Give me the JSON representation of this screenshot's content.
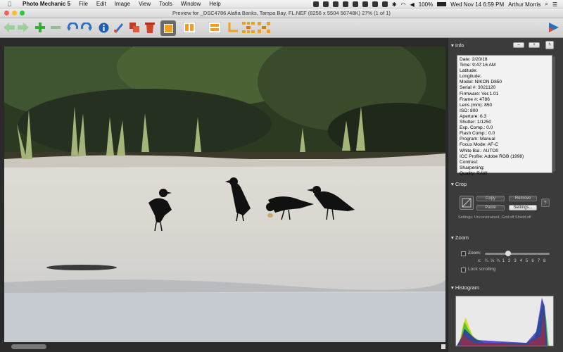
{
  "menubar": {
    "app_name": "Photo Mechanic 5",
    "menus": [
      "File",
      "Edit",
      "Image",
      "View",
      "Tools",
      "Window",
      "Help"
    ],
    "battery": "100%",
    "datetime": "Wed Nov 14  6:59 PM",
    "user": "Arthur Morris"
  },
  "window": {
    "title": "Preview for _DSC4786  Alafia Banks, Tampa Bay, FL.NEF (8256 x 5504 56748K) 27% (1 of 1)"
  },
  "panel": {
    "info": {
      "header": "Info",
      "lines": [
        "Date: 2/20/18",
        "Time: 9:47:16 AM",
        "Latitude:",
        "Longitude:",
        "Model: NIKON D850",
        "Serial #: 3021120",
        "Firmware: Ver.1.01",
        "Frame #: 4786",
        "Lens (mm): 850",
        "ISO: 800",
        "Aperture: 6.3",
        "Shutter: 1/1250",
        "Exp. Comp.: 0.0",
        "Flash Comp.: 0.0",
        "Program: Manual",
        "Focus Mode: AF-C",
        "White Bal.: AUTO0",
        "ICC Profile: Adobe RGB (1998)",
        "Contrast:",
        "Sharpening:",
        "Quality: RAW"
      ]
    },
    "crop": {
      "header": "Crop",
      "copy": "Copy",
      "remove": "Remove",
      "paste": "Paste",
      "settings": "Settings...",
      "settings_text": "Settings:   Unconstrained, Grid:off Shield:off"
    },
    "zoom": {
      "header": "Zoom",
      "zoom_label": "Zoom:",
      "scale": "x:   ¼  ⅓  ¾  1   2   3   4   5   6   7   8",
      "lock": "Lock scrolling",
      "slider_level": 0.35
    },
    "histogram": {
      "header": "Histogram"
    }
  },
  "colors": {
    "accent_orange": "#f0a020",
    "green_arrow": "#3aaa3a",
    "blue_icon": "#2a6fc4"
  }
}
